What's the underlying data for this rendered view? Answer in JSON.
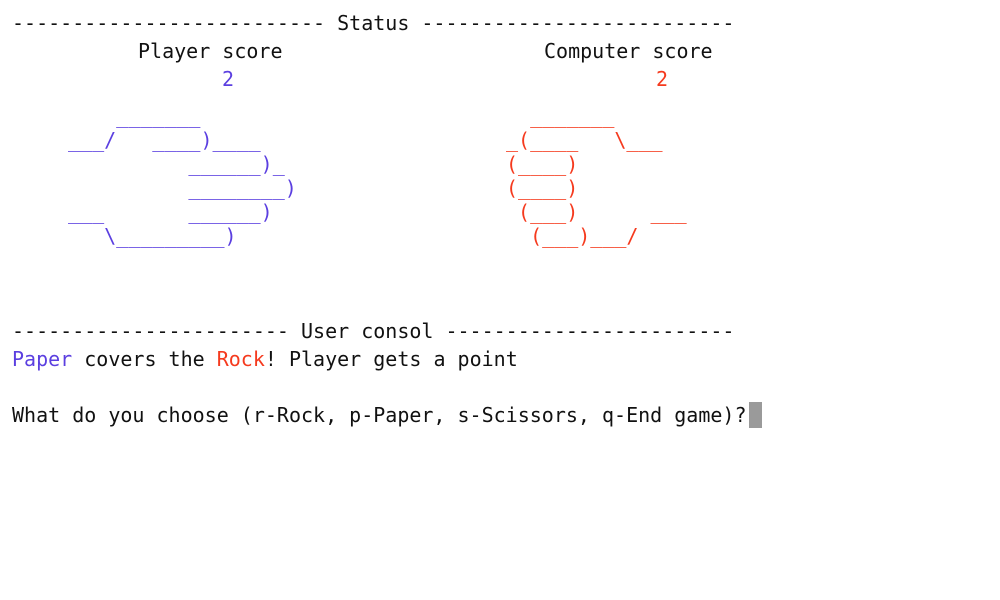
{
  "colors": {
    "player": "#5b3fe0",
    "computer": "#f53a1e",
    "text": "#111111",
    "cursor": "#9a9a9a"
  },
  "status": {
    "header": "-------------------------- Status --------------------------",
    "player_label": "Player score",
    "computer_label": "Computer score",
    "player_score": "2",
    "computer_score": "2"
  },
  "player_hand": {
    "name": "Paper",
    "art": "    _______\n___/   ____)____\n          ______)_\n          ________)\n___       ______)\n   \\_________)"
  },
  "computer_hand": {
    "name": "Rock",
    "art": "  _______\n_(____   \\___\n(____)\n(____)\n (___)      ___\n  (___)___/"
  },
  "console": {
    "header": "----------------------- User consol ------------------------",
    "result_player_word": "Paper",
    "result_middle": " covers the ",
    "result_computer_word": "Rock",
    "result_end": "! Player gets a point",
    "prompt": "What do you choose (r-Rock, p-Paper, s-Scissors, q-End game)?"
  }
}
